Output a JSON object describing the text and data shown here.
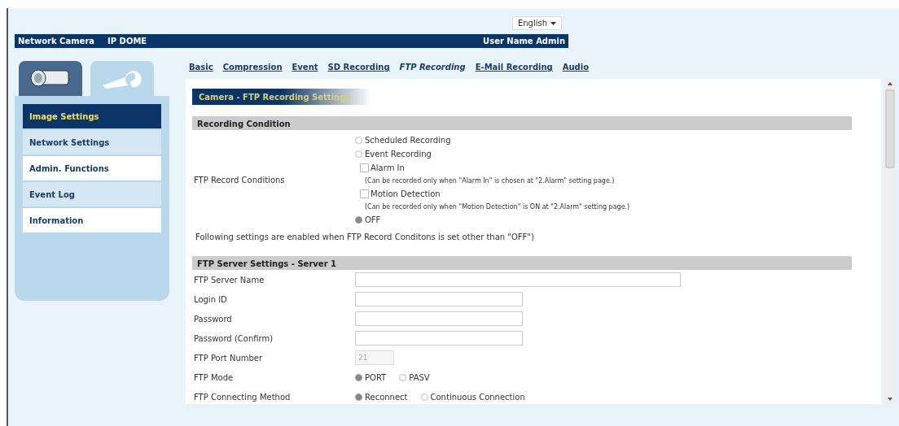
{
  "language": {
    "value": "English"
  },
  "header": {
    "product": "Network Camera",
    "model": "IP DOME",
    "user": "User Name Admin"
  },
  "side_tabs": [
    {
      "kind": "camera",
      "selected": false
    },
    {
      "kind": "settings",
      "selected": true
    }
  ],
  "menu": [
    {
      "label": "Image Settings",
      "selected": true
    },
    {
      "label": "Network Settings",
      "selected": false
    },
    {
      "label": "Admin. Functions",
      "selected": false
    },
    {
      "label": "Event Log",
      "selected": false
    },
    {
      "label": "Information",
      "selected": false
    }
  ],
  "tabs": [
    {
      "label": "Basic",
      "selected": false
    },
    {
      "label": "Compression",
      "selected": false
    },
    {
      "label": "Event",
      "selected": false
    },
    {
      "label": "SD Recording",
      "selected": false
    },
    {
      "label": "FTP Recording",
      "selected": true
    },
    {
      "label": "E-Mail Recording",
      "selected": false
    },
    {
      "label": "Audio",
      "selected": false
    }
  ],
  "page_title": "Camera - FTP Recording Settings",
  "sections": [
    {
      "heading": "Recording Condition",
      "rows": [
        {
          "kind": "options",
          "label": "FTP Record Conditions",
          "options": [
            {
              "kind": "radio",
              "label": "Scheduled Recording",
              "selected": false
            },
            {
              "kind": "radio",
              "label": "Event Recording",
              "selected": false
            },
            {
              "kind": "checkbox",
              "label": "Alarm In",
              "checked": false,
              "note": "(Can be recorded only when \"Alarm In\" is chosen at \"2.Alarm\" setting page.)"
            },
            {
              "kind": "checkbox",
              "label": "Motion Detection",
              "checked": false,
              "note": "(Can be recorded only when \"Motion Detection\" is ON at \"2.Alarm\" setting page.)"
            },
            {
              "kind": "radio",
              "label": "OFF",
              "selected": true
            }
          ]
        },
        {
          "kind": "note",
          "text": "Following settings are enabled when FTP Record Conditons is set other than \"OFF\")"
        }
      ]
    },
    {
      "heading": "FTP Server Settings - Server 1",
      "rows": [
        {
          "kind": "wide_text",
          "label": "FTP Server Name",
          "disabled": false
        },
        {
          "kind": "text",
          "label": "Login ID",
          "disabled": false
        },
        {
          "kind": "text",
          "label": "Password",
          "disabled": false
        },
        {
          "kind": "text",
          "label": "Password (Confirm)",
          "disabled": false
        },
        {
          "kind": "number",
          "label": "FTP Port Number",
          "value": "21",
          "disabled": true
        },
        {
          "kind": "radios",
          "label": "FTP Mode",
          "options": [
            {
              "label": "PORT",
              "selected": true
            },
            {
              "label": "PASV",
              "selected": false
            }
          ]
        },
        {
          "kind": "radios",
          "label": "FTP Connecting Method",
          "options": [
            {
              "label": "Reconnect",
              "selected": true
            },
            {
              "label": "Continuous Connection",
              "selected": false
            }
          ]
        }
      ]
    }
  ]
}
